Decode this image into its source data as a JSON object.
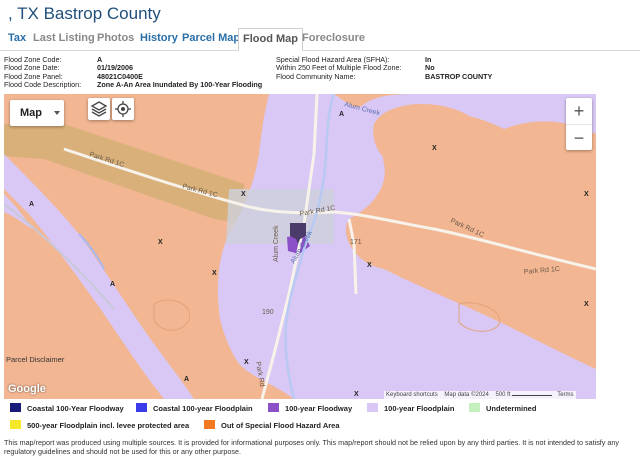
{
  "header": {
    "title": ", TX Bastrop County"
  },
  "tabs": [
    {
      "label": "Tax"
    },
    {
      "label": "Last Listing"
    },
    {
      "label": "Photos"
    },
    {
      "label": "History"
    },
    {
      "label": "Parcel Map"
    },
    {
      "label": "Flood Map"
    },
    {
      "label": "Foreclosure"
    }
  ],
  "flood_info": {
    "left": [
      {
        "label": "Flood Zone Code:",
        "value": "A"
      },
      {
        "label": "Flood Zone Date:",
        "value": "01/19/2006"
      },
      {
        "label": "Flood Zone Panel:",
        "value": "48021C0400E"
      },
      {
        "label": "Flood Code Description:",
        "value": "Zone A-An Area Inundated By 100-Year Flooding"
      }
    ],
    "right": [
      {
        "label": "Special Flood Hazard Area (SFHA):",
        "value": "In"
      },
      {
        "label": "Within 250 Feet of Multiple Flood Zone:",
        "value": "No"
      },
      {
        "label": "Flood Community Name:",
        "value": "BASTROP COUNTY"
      }
    ]
  },
  "map": {
    "type_label": "Map",
    "zoom_in": "+",
    "zoom_out": "−",
    "google": "Google",
    "parcel_disclaimer": "Parcel Disclaimer",
    "attribution": {
      "shortcuts": "Keyboard shortcuts",
      "data": "Map data ©2024",
      "scale": "500 ft",
      "terms": "Terms"
    },
    "roads": [
      "Park Rd 1C",
      "Park Rd 1C",
      "Park Rd 1C",
      "Park Rd 1C",
      "Park Rd 1C",
      "Alum Creek",
      "Alum Creek",
      "Alum Creek",
      "Park Rd",
      "190",
      "171"
    ],
    "zone_labels": [
      "A",
      "A",
      "A",
      "A",
      "X",
      "X",
      "X",
      "X",
      "X",
      "X",
      "X",
      "X",
      "X"
    ]
  },
  "legend": [
    {
      "label": "Coastal 100-Year Floodway",
      "color": "#1a1a7a"
    },
    {
      "label": "Coastal 100-year Floodplain",
      "color": "#3b3bea"
    },
    {
      "label": "100-year Floodway",
      "color": "#8b4fc8"
    },
    {
      "label": "100-year Floodplain",
      "color": "#d9c8f5"
    },
    {
      "label": "Undetermined",
      "color": "#c6efc0"
    },
    {
      "label": "500-year Floodplain incl. levee protected area",
      "color": "#f5e829"
    },
    {
      "label": "Out of Special Flood Hazard Area",
      "color": "#f37a20"
    }
  ],
  "disclaimer": "This map/report was produced using multiple sources. It is provided for informational purposes only. This map/report should not be relied upon by any third parties. It is not intended to satisfy any regulatory guidelines and should not be used for this or any other purpose."
}
